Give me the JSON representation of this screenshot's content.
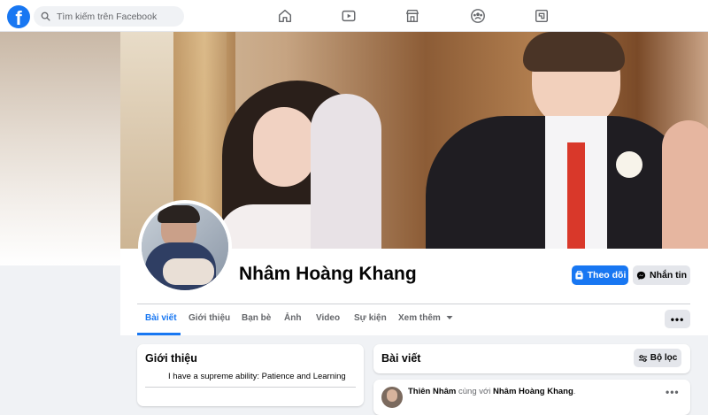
{
  "topbar": {
    "logo": "f",
    "search_placeholder": "Tìm kiếm trên Facebook",
    "nav_icons": [
      "home-icon",
      "watch-icon",
      "marketplace-icon",
      "groups-icon",
      "gaming-icon"
    ]
  },
  "profile": {
    "name": "Nhâm Hoàng Khang",
    "follow_label": "Theo dõi",
    "message_label": "Nhắn tin"
  },
  "tabs": [
    {
      "label": "Bài viết",
      "active": true
    },
    {
      "label": "Giới thiệu",
      "active": false
    },
    {
      "label": "Bạn bè",
      "active": false
    },
    {
      "label": "Ảnh",
      "active": false
    },
    {
      "label": "Video",
      "active": false
    },
    {
      "label": "Sự kiện",
      "active": false
    },
    {
      "label": "Xem thêm",
      "active": false
    }
  ],
  "more_button": "•••",
  "intro": {
    "title": "Giới thiệu",
    "bio": "I have a supreme ability: Patience and Learning"
  },
  "posts": {
    "title": "Bài viết",
    "filter_label": "Bộ lọc",
    "first_post": {
      "author": "Thiên Nhâm",
      "with_text": "cùng với",
      "tagged": "Nhâm Hoàng Khang",
      "suffix": "."
    },
    "post_menu": "•••"
  },
  "colors": {
    "accent": "#1877f2",
    "background": "#f0f2f5",
    "button_grey": "#e4e6eb"
  }
}
